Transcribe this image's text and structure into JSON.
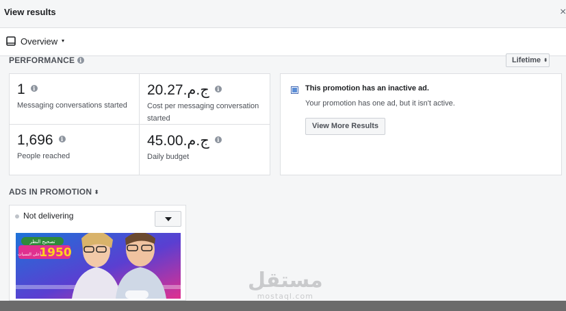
{
  "header": {
    "title": "View results",
    "close_symbol": "×"
  },
  "view_selector": {
    "label": "Overview",
    "caret": "▾",
    "icon": "tablet-icon"
  },
  "performance": {
    "title": "PERFORMANCE",
    "range": {
      "label": "Lifetime",
      "arrows": "⬍"
    },
    "stats": [
      {
        "value": "1",
        "label": "Messaging conversations started"
      },
      {
        "value": "ج.م.20.27",
        "label": "Cost per messaging conversation started"
      },
      {
        "value": "1,696",
        "label": "People reached"
      },
      {
        "value": "ج.م.45.00",
        "label": "Daily budget"
      }
    ]
  },
  "notice": {
    "title": "This promotion has an inactive ad.",
    "text": "Your promotion has one ad, but it isn't active.",
    "button": "View More Results"
  },
  "ads_section": {
    "title": "ADS IN PROMOTION",
    "sort_arrows": "⬍",
    "ad": {
      "status": "Not delivering",
      "thumbnail": {
        "badge_top": "تصحيح النظر",
        "price": "1950",
        "badge_bottom": "أعلى النسبات"
      }
    }
  },
  "watermark": {
    "arabic": "مستقل",
    "latin": "mostaql.com"
  },
  "colors": {
    "page_bg": "#f5f6f7",
    "accent_blue": "#4267b2",
    "thumb_blue": "#1e73d8",
    "thumb_pink": "#e0308f",
    "price_yellow": "#ffd21f"
  }
}
